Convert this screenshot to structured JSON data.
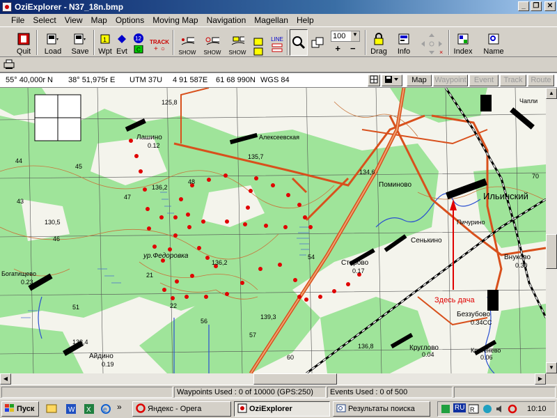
{
  "window": {
    "title": "OziExplorer - N37_18n.bmp"
  },
  "menu": [
    "File",
    "Select",
    "View",
    "Map",
    "Options",
    "Moving Map",
    "Navigation",
    "Magellan",
    "Help"
  ],
  "toolbar": {
    "quit": "Quit",
    "load": "Load",
    "save": "Save",
    "wpt": "Wpt",
    "evt": "Evt",
    "track": "TRACK",
    "twelve": "12",
    "show": "SHOW",
    "zoom_value": "100",
    "plus": "+",
    "minus": "−",
    "line": "LINE",
    "drag": "Drag",
    "info": "Info",
    "index": "Index",
    "name": "Name"
  },
  "info": {
    "lat": "55° 40,000r N",
    "lon": "38° 51,975r E",
    "utm_zone": "UTM  37U",
    "easting": "4 91 587E",
    "northing": "61 68 990N",
    "datum": "WGS 84",
    "tabs": {
      "map": "Map",
      "waypoint": "Waypoint",
      "event": "Event",
      "track": "Track",
      "route": "Route"
    }
  },
  "map": {
    "labels": {
      "lashino": "Лашино",
      "lashino_num": "0.12",
      "alekseevskaya": "Алексеевская",
      "pominovo": "Поминово",
      "ilyinsky": "Ильинский",
      "chapli": "Чапли",
      "starovo": "Старово",
      "starovo_num": "0.17",
      "senkino": "Сенькино",
      "pichurino": "Пичурино",
      "bogatishchevo": "Богатищево",
      "bogatishchevo_num": "0.23",
      "fedorovka": "ур.Федоровка",
      "kruglovo": "Круглово",
      "kruglovo_num": "0.04",
      "aydino": "Айдино",
      "aydino_num": "0.19",
      "vnukovo": "Внуково",
      "vnukovo_num": "0.30",
      "bezzubovo": "Беззубово",
      "bezzubovo_num": "0.34СС",
      "kostenevo": "Костенево",
      "kostenevo_num": "0.06",
      "elev_1362a": "136,2",
      "elev_1362b": "136,2",
      "elev_1346": "134,6",
      "elev_1357": "135,7",
      "elev_1393": "139,3",
      "elev_1368": "136,8",
      "elev_1305": "130,5",
      "elev_1334": "133,4",
      "elev_1258": "125,8",
      "grid_48": "48",
      "grid_47": "47",
      "grid_43": "43",
      "grid_46": "46",
      "grid_45": "45",
      "grid_21": "21",
      "grid_22": "22",
      "grid_57": "57",
      "grid_60": "60",
      "grid_54": "54",
      "grid_55": "56",
      "grid_44": "44",
      "grid_70": "70",
      "grid_56": "56",
      "grid_51": "51",
      "annotation": "Здесь дача"
    }
  },
  "status": {
    "waypoints": "Waypoints Used : 0 of 10000  (GPS:250)",
    "events": "Events Used : 0 of 500"
  },
  "taskbar": {
    "start": "Пуск",
    "opera": "Яндекс - Opera",
    "ozi": "OziExplorer",
    "search": "Результаты поиска",
    "lang": "RU",
    "time": "10:10"
  }
}
